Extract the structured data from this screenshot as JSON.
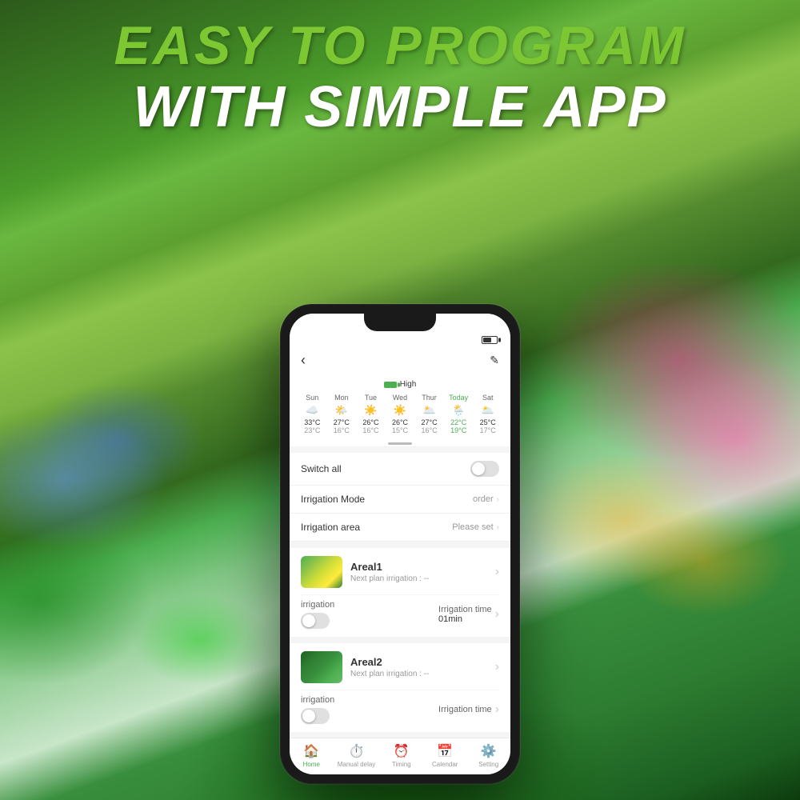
{
  "title": {
    "line1": "EASY TO PROGRAM",
    "line2": "WITH SIMPLE APP"
  },
  "phone": {
    "status": {
      "battery": "High"
    },
    "weather": {
      "days": [
        {
          "name": "Sun",
          "icon": "☁️",
          "high": "33°C",
          "low": "23°C",
          "today": false
        },
        {
          "name": "Mon",
          "icon": "🌤️",
          "high": "27°C",
          "low": "16°C",
          "today": false
        },
        {
          "name": "Tue",
          "icon": "☀️",
          "high": "26°C",
          "low": "16°C",
          "today": false
        },
        {
          "name": "Wed",
          "icon": "☀️",
          "high": "26°C",
          "low": "15°C",
          "today": false
        },
        {
          "name": "Thur",
          "icon": "🌥️",
          "high": "27°C",
          "low": "16°C",
          "today": false
        },
        {
          "name": "Today",
          "icon": "🌦️",
          "high": "22°C",
          "low": "19°C",
          "today": true
        },
        {
          "name": "Sat",
          "icon": "🌥️",
          "high": "25°C",
          "low": "17°C",
          "today": false
        }
      ]
    },
    "settings": {
      "switch_all_label": "Switch all",
      "irrigation_mode_label": "Irrigation Mode",
      "irrigation_mode_value": "order",
      "irrigation_area_label": "Irrigation area",
      "irrigation_area_value": "Please set"
    },
    "areas": [
      {
        "id": "area1",
        "name": "Areal1",
        "next_label": "Next plan irrigation : --",
        "irrigation_label": "irrigation",
        "time_label": "Irrigation time",
        "time_value": "01min",
        "thumb_dark": false
      },
      {
        "id": "area2",
        "name": "Areal2",
        "next_label": "Next plan irrigation : --",
        "irrigation_label": "irrigation",
        "time_label": "Irrigation time",
        "time_value": "",
        "thumb_dark": true
      }
    ],
    "nav": {
      "items": [
        {
          "label": "Home",
          "icon": "🏠",
          "active": true
        },
        {
          "label": "Manual delay",
          "icon": "⏱️",
          "active": false
        },
        {
          "label": "Timing",
          "icon": "⏰",
          "active": false
        },
        {
          "label": "Calendar",
          "icon": "📅",
          "active": false
        },
        {
          "label": "Setting",
          "icon": "⚙️",
          "active": false
        }
      ]
    }
  }
}
